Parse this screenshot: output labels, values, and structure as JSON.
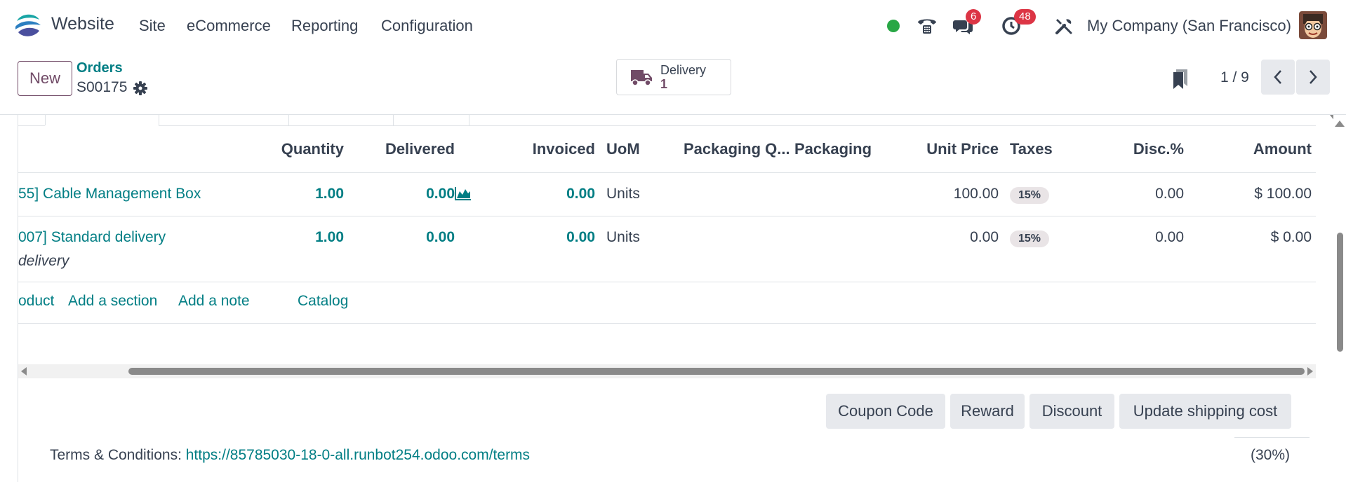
{
  "navbar": {
    "app_name": "Website",
    "menu": [
      "Site",
      "eCommerce",
      "Reporting",
      "Configuration"
    ],
    "messages_count": "6",
    "activities_count": "48",
    "company": "My Company (San Francisco)",
    "status_color": "#28a745",
    "icons": [
      "status-dot-icon",
      "phone-icon",
      "chat-icon",
      "clock-icon",
      "tools-icon"
    ]
  },
  "control_panel": {
    "new_label": "New",
    "breadcrumb_parent": "Orders",
    "record_name": "S00175",
    "smart_button": {
      "label": "Delivery",
      "value": "1"
    },
    "pager": "1 / 9"
  },
  "table": {
    "headers": [
      "Quantity",
      "Delivered",
      "Invoiced",
      "UoM",
      "Packaging Q...",
      "Packaging",
      "Unit Price",
      "Taxes",
      "Disc.%",
      "Amount"
    ],
    "rows": [
      {
        "product": "55] Cable Management Box",
        "note": "",
        "quantity": "1.00",
        "delivered": "0.00",
        "invoiced": "0.00",
        "uom": "Units",
        "unit_price": "100.00",
        "taxes": "15%",
        "discount": "0.00",
        "amount": "$ 100.00"
      },
      {
        "product": "007] Standard delivery",
        "note": "delivery",
        "quantity": "1.00",
        "delivered": "0.00",
        "invoiced": "0.00",
        "uom": "Units",
        "unit_price": "0.00",
        "taxes": "15%",
        "discount": "0.00",
        "amount": "$ 0.00"
      }
    ],
    "add_links": [
      "oduct",
      "Add a section",
      "Add a note",
      "Catalog"
    ]
  },
  "actions": [
    "Coupon Code",
    "Reward",
    "Discount",
    "Update shipping cost"
  ],
  "terms": {
    "label": "Terms & Conditions:",
    "url": "https://85785030-18-0-all.runbot254.odoo.com/terms"
  },
  "percent_text": "(30%)",
  "colors": {
    "brand": "#714b67",
    "link": "#017e84",
    "badge": "#dc3545"
  }
}
